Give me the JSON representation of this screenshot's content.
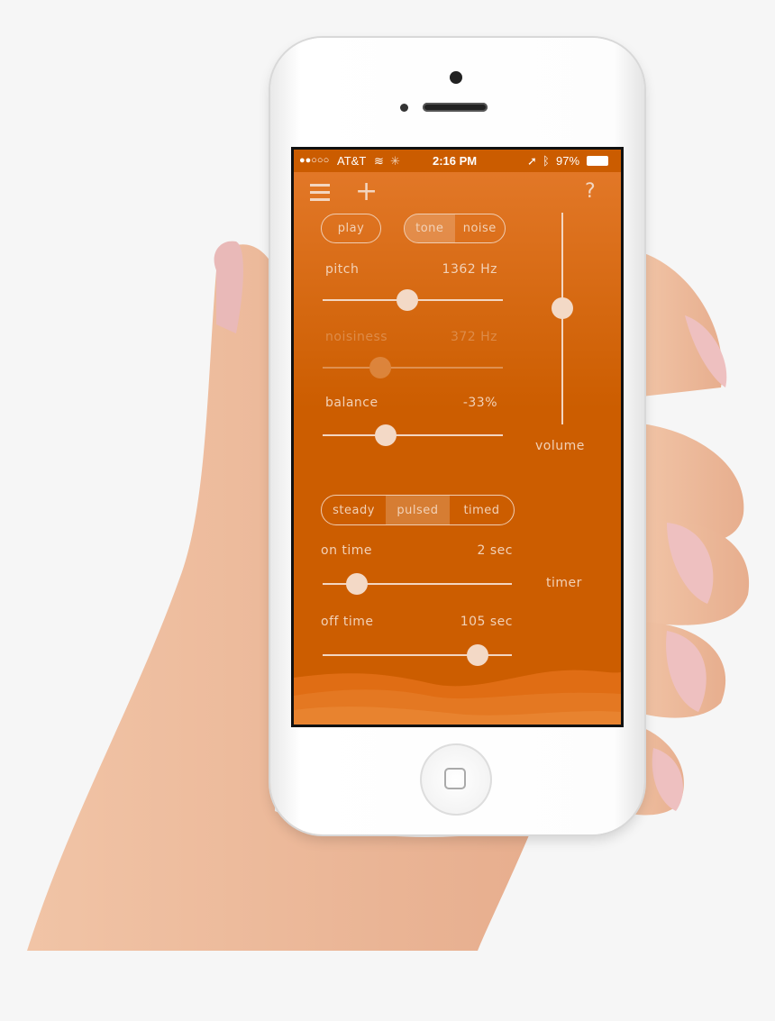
{
  "status_bar": {
    "signal": "●●○○○",
    "carrier": "AT&T",
    "time": "2:16 PM",
    "battery": "97%",
    "icons": [
      "wifi-icon",
      "activity-spinner-icon",
      "location-arrow-icon",
      "bluetooth-icon",
      "battery-icon"
    ]
  },
  "toolbar": {
    "menu_icon": "hamburger-icon",
    "add_icon": "plus-icon",
    "help_label": "?"
  },
  "play_label": "play",
  "source_toggle": {
    "options": [
      "tone",
      "noise"
    ],
    "selected": "tone"
  },
  "pitch": {
    "label": "pitch",
    "value": "1362 Hz",
    "fraction": 0.47
  },
  "noisiness": {
    "label": "noisiness",
    "value": "372 Hz",
    "fraction": 0.32,
    "disabled": true
  },
  "balance": {
    "label": "balance",
    "value": "-33%",
    "fraction": 0.35
  },
  "volume": {
    "label": "volume",
    "fraction": 0.55
  },
  "mode_toggle": {
    "options": [
      "steady",
      "pulsed",
      "timed"
    ],
    "selected": "pulsed"
  },
  "on_time": {
    "label": "on time",
    "value": "2 sec",
    "fraction": 0.18
  },
  "off_time": {
    "label": "off time",
    "value": "105 sec",
    "fraction": 0.82
  },
  "timer_label": "timer",
  "colors": {
    "accent": "#cc5d00",
    "accent_light": "#e47a2b",
    "control": "#f3d6c1"
  }
}
